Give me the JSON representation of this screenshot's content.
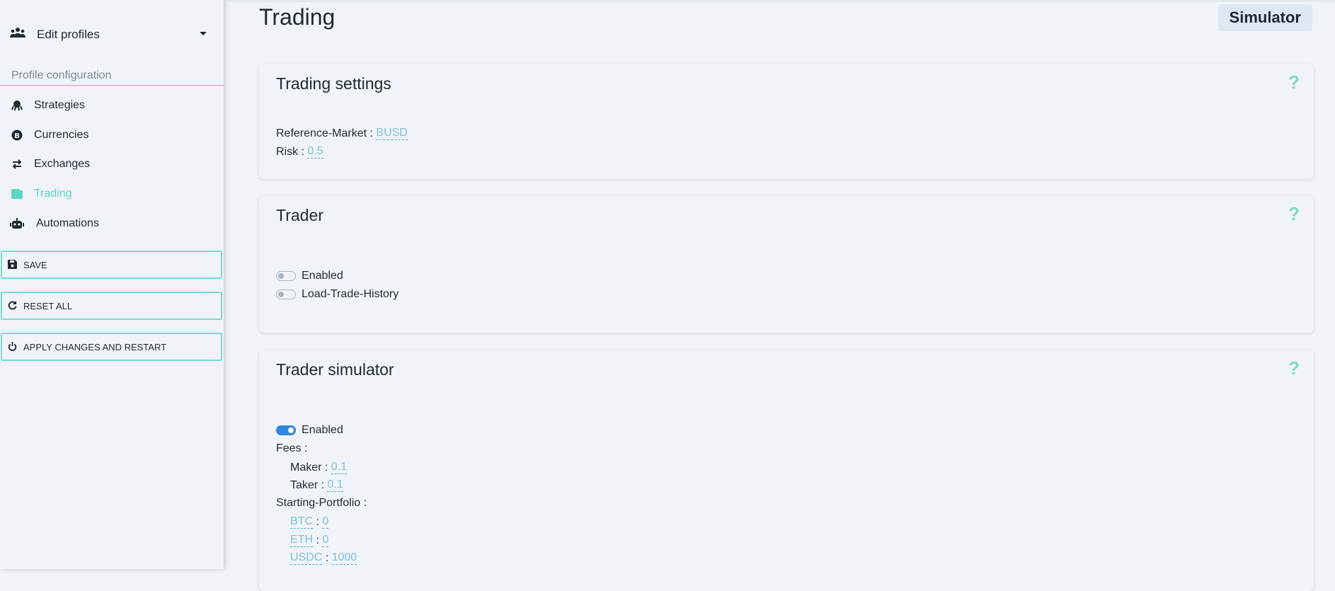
{
  "sidebar": {
    "profile_label": "Edit profiles",
    "section_title": "Profile configuration",
    "items": [
      {
        "label": "Strategies",
        "icon": "octopus-icon"
      },
      {
        "label": "Currencies",
        "icon": "bitcoin-icon"
      },
      {
        "label": "Exchanges",
        "icon": "exchange-arrows-icon"
      },
      {
        "label": "Trading",
        "icon": "wallet-icon",
        "active": true
      },
      {
        "label": "Automations",
        "icon": "robot-icon"
      }
    ],
    "buttons": {
      "save": "SAVE",
      "reset": "RESET ALL",
      "apply": "APPLY CHANGES AND RESTART"
    }
  },
  "main": {
    "title": "Trading",
    "badge": "Simulator",
    "trading_settings": {
      "title": "Trading settings",
      "help": "?",
      "reference_market_label": "Reference-Market",
      "reference_market_value": "BUSD",
      "risk_label": "Risk",
      "risk_value": "0.5"
    },
    "trader": {
      "title": "Trader",
      "help": "?",
      "enabled_label": "Enabled",
      "enabled": false,
      "load_history_label": "Load-Trade-History",
      "load_history": false
    },
    "trader_simulator": {
      "title": "Trader simulator",
      "help": "?",
      "enabled_label": "Enabled",
      "enabled": true,
      "fees_label": "Fees",
      "maker_label": "Maker",
      "maker_value": "0.1",
      "taker_label": "Taker",
      "taker_value": "0.1",
      "portfolio_label": "Starting-Portfolio",
      "portfolio": [
        {
          "asset": "BTC",
          "amount": "0"
        },
        {
          "asset": "ETH",
          "amount": "0"
        },
        {
          "asset": "USDC",
          "amount": "1000"
        }
      ]
    }
  },
  "colors": {
    "accent": "#5ad6c8",
    "value_link": "#7fbfd8",
    "toggle_on": "#2e86de"
  }
}
